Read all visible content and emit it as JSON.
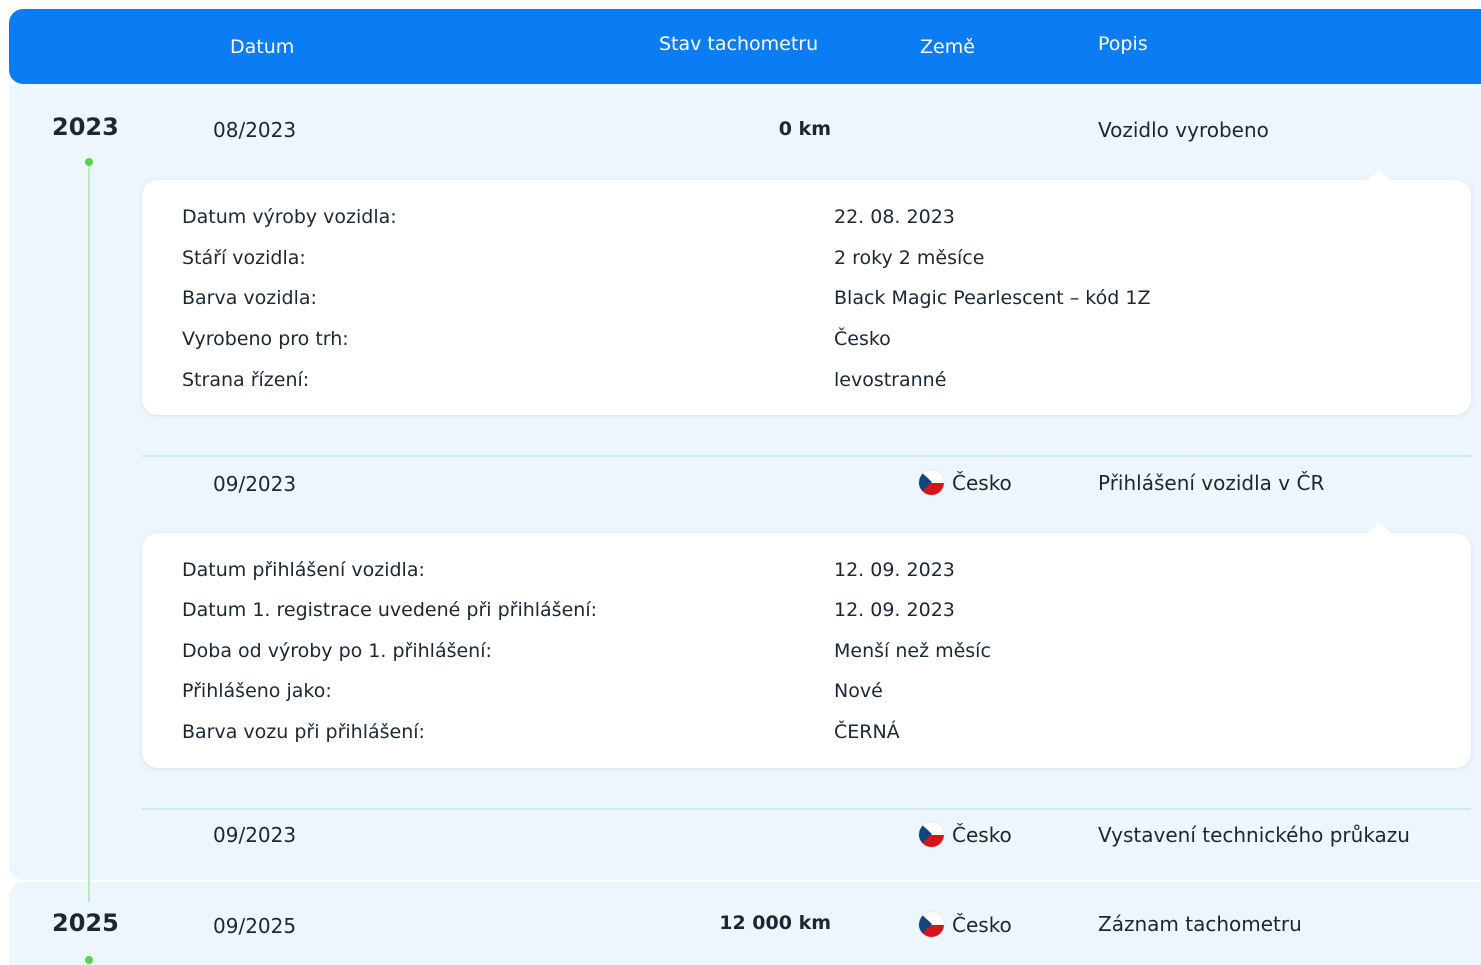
{
  "header": {
    "date": "Datum",
    "odometer": "Stav tachometru",
    "country": "Země",
    "description": "Popis"
  },
  "years": [
    "2023",
    "2025"
  ],
  "rows": [
    {
      "date": "08/2023",
      "odometer": "0 km",
      "country": "",
      "description": "Vozidlo vyrobeno"
    },
    {
      "date": "09/2023",
      "odometer": "",
      "country": "Česko",
      "description": "Přihlášení vozidla v ČR"
    },
    {
      "date": "09/2023",
      "odometer": "",
      "country": "Česko",
      "description": "Vystavení technického průkazu"
    },
    {
      "date": "09/2025",
      "odometer": "12 000 km",
      "country": "Česko",
      "description": "Záznam tachometru"
    }
  ],
  "details_production": [
    {
      "label": "Datum výroby vozidla:",
      "value": "22. 08. 2023"
    },
    {
      "label": "Stáří vozidla:",
      "value": "2 roky 2 měsíce"
    },
    {
      "label": "Barva vozidla:",
      "value": "Black Magic Pearlescent – kód 1Z"
    },
    {
      "label": "Vyrobeno pro trh:",
      "value": "Česko"
    },
    {
      "label": "Strana řízení:",
      "value": "levostranné"
    }
  ],
  "details_registration": [
    {
      "label": "Datum přihlášení vozidla:",
      "value": "12. 09. 2023"
    },
    {
      "label": "Datum 1. registrace uvedené při přihlášení:",
      "value": "12. 09. 2023"
    },
    {
      "label": "Doba od výroby po 1. přihlášení:",
      "value": "Menší než měsíc"
    },
    {
      "label": "Přihlášeno jako:",
      "value": "Nové"
    },
    {
      "label": "Barva vozu při přihlášení:",
      "value": "ČERNÁ"
    }
  ],
  "icons": {
    "flag": "czech-flag-icon"
  },
  "colors": {
    "header_bg": "#0a7cf4",
    "section_bg": "#eef6fd",
    "timeline_dot": "#56d34a",
    "card_bg": "#ffffff"
  }
}
